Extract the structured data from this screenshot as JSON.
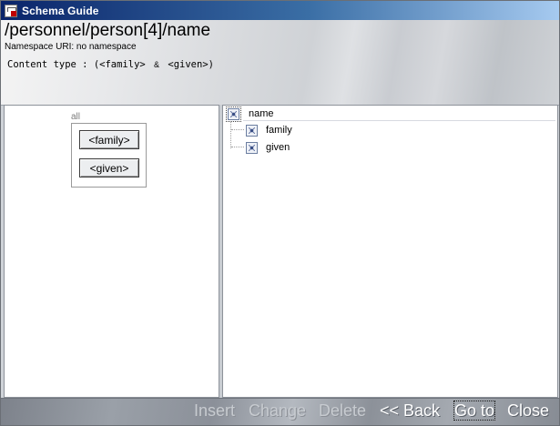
{
  "window": {
    "title": "Schema Guide"
  },
  "header": {
    "xpath": "/personnel/person[4]/name",
    "namespace": "Namespace URI: no namespace",
    "content_type_prefix": "Content type : (<family>",
    "content_type_amp": "&",
    "content_type_suffix": "<given>)"
  },
  "left_pane": {
    "group_label": "all",
    "elements": [
      "<family>",
      "<given>"
    ]
  },
  "tree": {
    "root": {
      "label": "name",
      "icon": "element-node-icon"
    },
    "children": [
      {
        "label": "family",
        "icon": "element-node-icon"
      },
      {
        "label": "given",
        "icon": "element-node-icon"
      }
    ]
  },
  "toolbar": {
    "insert": "Insert",
    "change": "Change",
    "delete": "Delete",
    "back": "<< Back",
    "goto": "Go to",
    "close": "Close"
  },
  "colors": {
    "title_bar": "#0a246a",
    "enabled_text": "#ffffff",
    "disabled_text": "#c7cbd0"
  }
}
